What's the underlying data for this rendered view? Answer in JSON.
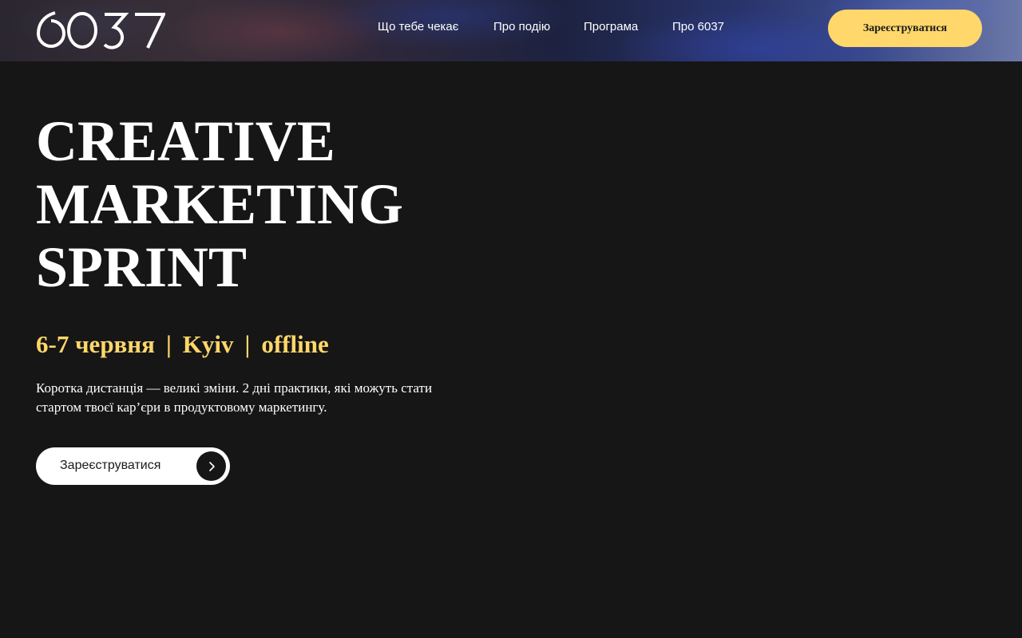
{
  "header": {
    "logo_text": "6037",
    "nav": [
      {
        "label": "Що тебе чекає"
      },
      {
        "label": "Про подію"
      },
      {
        "label": "Програма"
      },
      {
        "label": "Про 6037"
      }
    ],
    "cta_label": "Зареєструватися"
  },
  "hero": {
    "title_lines": [
      "CREATIVE",
      "MARKETING",
      "SPRINT"
    ],
    "dates": "6-7 червня",
    "separator": "|",
    "city": "Kyiv",
    "format": "offline",
    "description": "Коротка дистанція — великі зміни. 2 дні практики, які можуть стати стартом твоєї кар’єри в продуктовому маркетингу.",
    "register_label": "Зареєструватися"
  },
  "colors": {
    "background": "#161616",
    "accent": "#ffd76a",
    "text": "#ffffff"
  }
}
